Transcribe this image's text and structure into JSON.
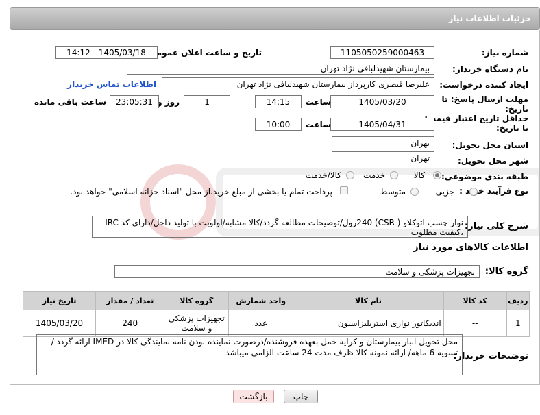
{
  "header": {
    "title": "جزئیات اطلاعات نیاز"
  },
  "form": {
    "need_number_label": "شماره نیاز:",
    "need_number": "1105050259000463",
    "announce_label": "تاریخ و ساعت اعلان عمومی:",
    "announce_value": "1405/03/18 - 14:12",
    "buyer_org_label": "نام دستگاه خریدار:",
    "buyer_org": "بیمارستان شهیدلبافی نژاد تهران",
    "creator_label": "ایجاد کننده درخواست:",
    "creator": "علیرضا قیصری کارپرداز بیمارستان شهیدلبافی نژاد تهران",
    "contact_link": "اطلاعات تماس خریدار",
    "deadline_label_1": "مهلت ارسال پاسخ: تا",
    "deadline_label_2": "تاریخ:",
    "deadline_date": "1405/03/20",
    "time_word": "ساعت",
    "deadline_time": "14:15",
    "days_value": "1",
    "days_word": "روز و",
    "remaining_time": "23:05:31",
    "remaining_word": "ساعت باقی مانده",
    "price_label_1": "حداقل تاریخ اعتبار قیمت:",
    "price_label_2": "تا تاریخ:",
    "price_date": "1405/04/31",
    "price_time": "10:00",
    "province_label": "استان محل تحویل:",
    "province": "تهران",
    "city_label": "شهر محل تحویل:",
    "city": "تهران",
    "category_label": "طبقه بندی موضوعی:",
    "cat_goods": "کالا",
    "cat_service": "خدمت",
    "cat_goods_service": "کالا/خدمت",
    "process_label": "نوع فرآیند خرید :",
    "proc_partial": "جزیی",
    "proc_medium": "متوسط",
    "payment_note": "پرداخت تمام یا بخشی از مبلغ خرید،از محل \"اسناد خزانه اسلامی\" خواهد بود."
  },
  "description": {
    "label": "شرح کلی نیاز:",
    "text_line1": "نوار چسب اتوکلاو ( CSR) 240رول/توصیحات مطالعه گردد/کالا مشابه/اولویت با تولید داخل/دارای کد IRC",
    "text_line2": "،کیفیت مطلوب"
  },
  "goods": {
    "section_title": "اطلاعات کالاهای مورد نیاز",
    "group_label": "گروه کالا:",
    "group_value": "تجهیزات پزشکی و سلامت",
    "columns": [
      "ردیف",
      "کد کالا",
      "نام کالا",
      "واحد شمارش",
      "گروه کالا",
      "تعداد / مقدار",
      "تاریخ نیاز"
    ],
    "rows": [
      [
        "1",
        "--",
        "اندیکاتور نواری استریلیزاسیون",
        "عدد",
        "تجهیزات پزشکی و سلامت",
        "240",
        "1405/03/20"
      ]
    ]
  },
  "buyer_notes": {
    "label": "توضیحات خریدار:",
    "line1": "محل تحویل انبار بیمارستان و کرایه حمل بعهده فروشنده/درصورت نماینده بودن نامه نمایندگی کالا در  IMED ارائه گردد /",
    "line2": "تسویه 6 ماهه/ ارائه نمونه کالا ظرف مدت 24 ساعت الزامی میباشد"
  },
  "buttons": {
    "print": "چاپ",
    "back": "بازگشت"
  }
}
